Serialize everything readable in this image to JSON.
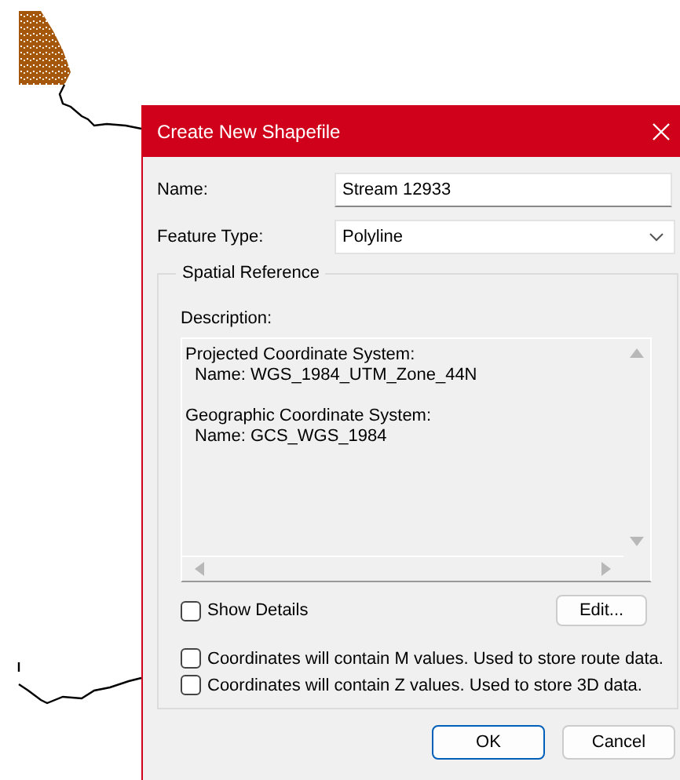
{
  "dialog": {
    "title": "Create New Shapefile",
    "name_field": {
      "label": "Name:",
      "value": "Stream 12933"
    },
    "feature_type": {
      "label": "Feature Type:",
      "value": "Polyline"
    },
    "spatial_reference": {
      "title": "Spatial Reference",
      "description_label": "Description:",
      "description": [
        {
          "text": "Projected Coordinate System:",
          "children": [
            {
              "text": "Name: WGS_1984_UTM_Zone_44N"
            }
          ]
        },
        {
          "text": "Geographic Coordinate System:",
          "children": [
            {
              "text": "Name: GCS_WGS_1984"
            }
          ]
        }
      ],
      "show_details": {
        "label": "Show Details",
        "checked": false
      },
      "edit_button": "Edit...",
      "options": [
        {
          "label": "Coordinates will contain M values. Used to store route data.",
          "checked": false
        },
        {
          "label": "Coordinates will contain Z values. Used to store 3D data.",
          "checked": false
        }
      ]
    },
    "buttons": [
      {
        "label": "OK",
        "default": true
      },
      {
        "label": "Cancel",
        "default": false
      }
    ]
  }
}
